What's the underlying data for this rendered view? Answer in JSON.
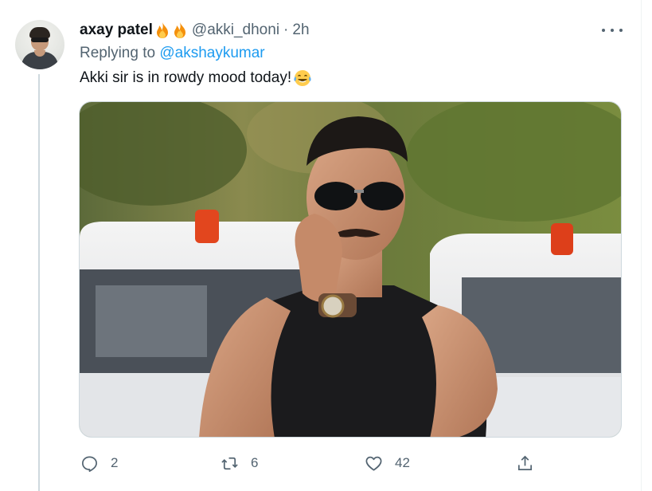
{
  "tweet": {
    "author_name": "axay patel",
    "author_emojis": [
      "fire",
      "fire"
    ],
    "handle": "@akki_dhoni",
    "separator": "·",
    "time": "2h",
    "replying_to_label": "Replying to",
    "replying_to_handle": "@akshaykumar",
    "text": "Akki sir is in rowdy mood today!",
    "text_emoji": "face-with-tears-of-joy",
    "media": {
      "kind": "photo",
      "subject": "man in black aviator sunglasses and black tank top touching his moustache, cars with red beacon lights behind"
    }
  },
  "actions": {
    "reply": {
      "icon": "reply-icon",
      "count": "2"
    },
    "retweet": {
      "icon": "retweet-icon",
      "count": "6"
    },
    "like": {
      "icon": "heart-icon",
      "count": "42"
    },
    "share": {
      "icon": "share-icon"
    }
  },
  "colors": {
    "text_primary": "#0f1419",
    "text_secondary": "#536471",
    "link": "#1d9bf0",
    "border": "#cfd9de"
  }
}
